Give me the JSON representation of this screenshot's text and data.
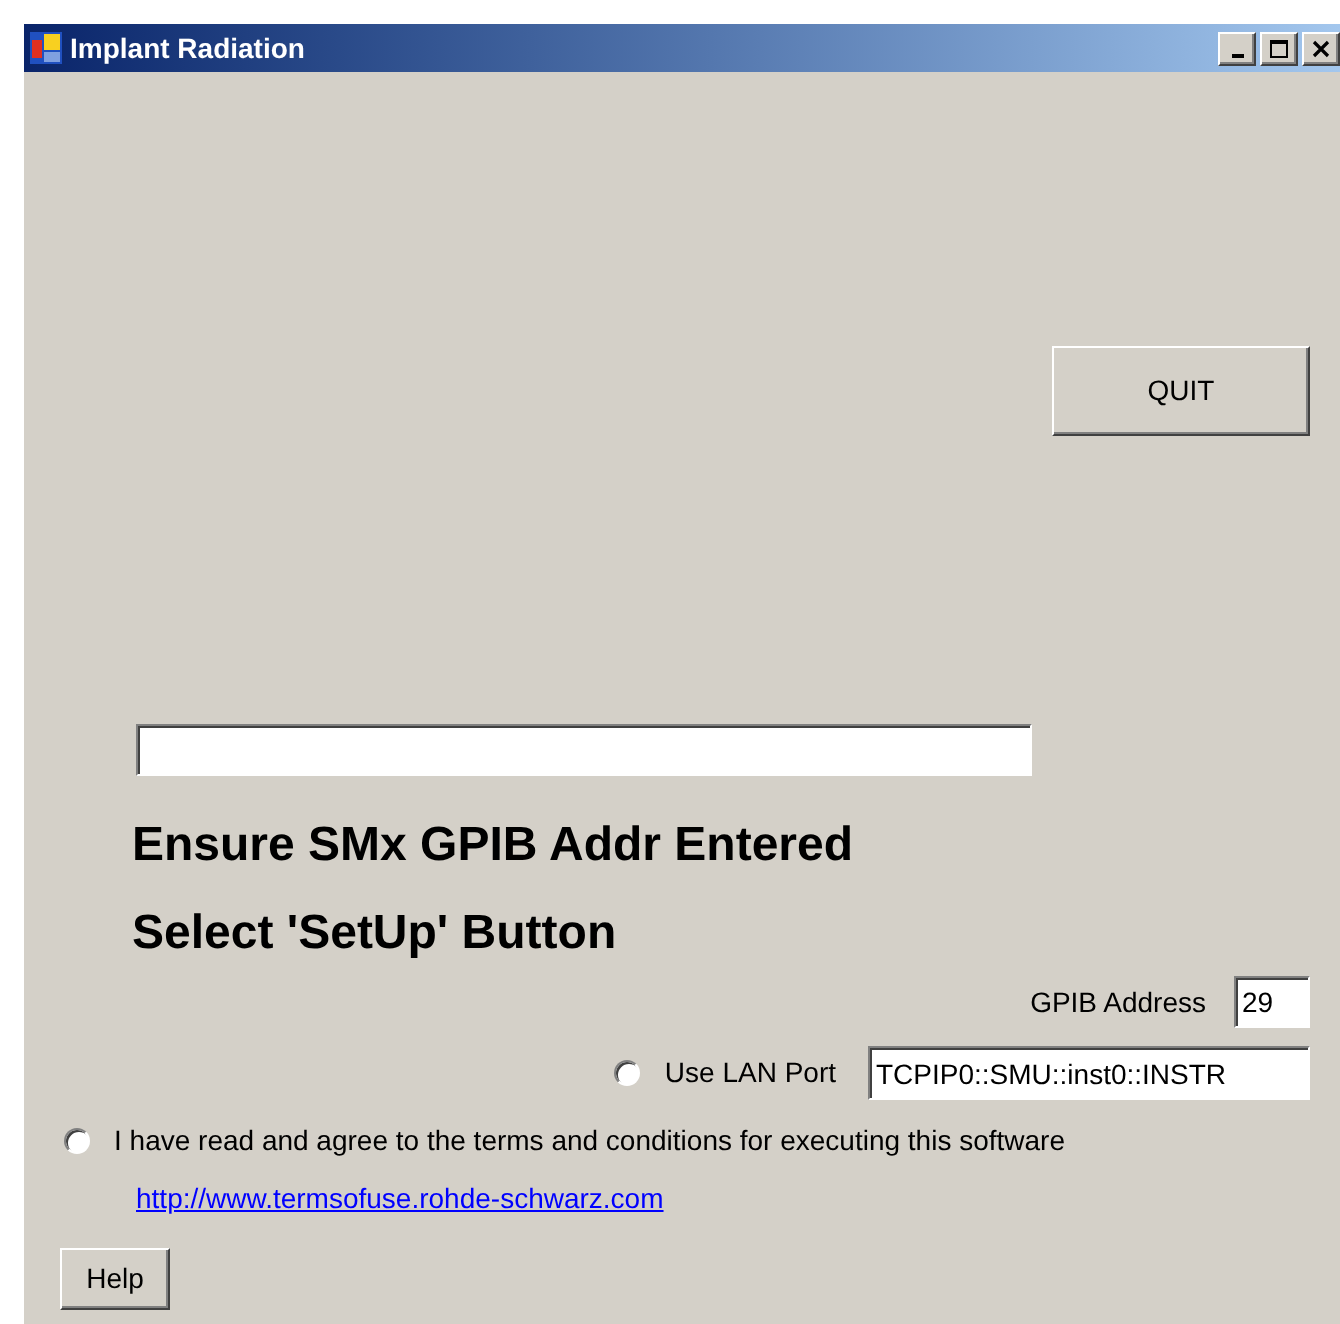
{
  "window": {
    "title": "Implant Radiation"
  },
  "quit_button": "QUIT",
  "instructions": [
    "Ensure SMx GPIB Addr Entered",
    "Select 'SetUp' Button"
  ],
  "gpib": {
    "label": "GPIB Address",
    "value": "29"
  },
  "lan": {
    "label": "Use LAN Port",
    "selected": false,
    "value": "TCPIP0::SMU::inst0::INSTR"
  },
  "terms": {
    "label": "I have read and agree to the terms and conditions for executing this software",
    "selected": false,
    "link": "http://www.termsofuse.rohde-schwarz.com"
  },
  "help_button": "Help"
}
